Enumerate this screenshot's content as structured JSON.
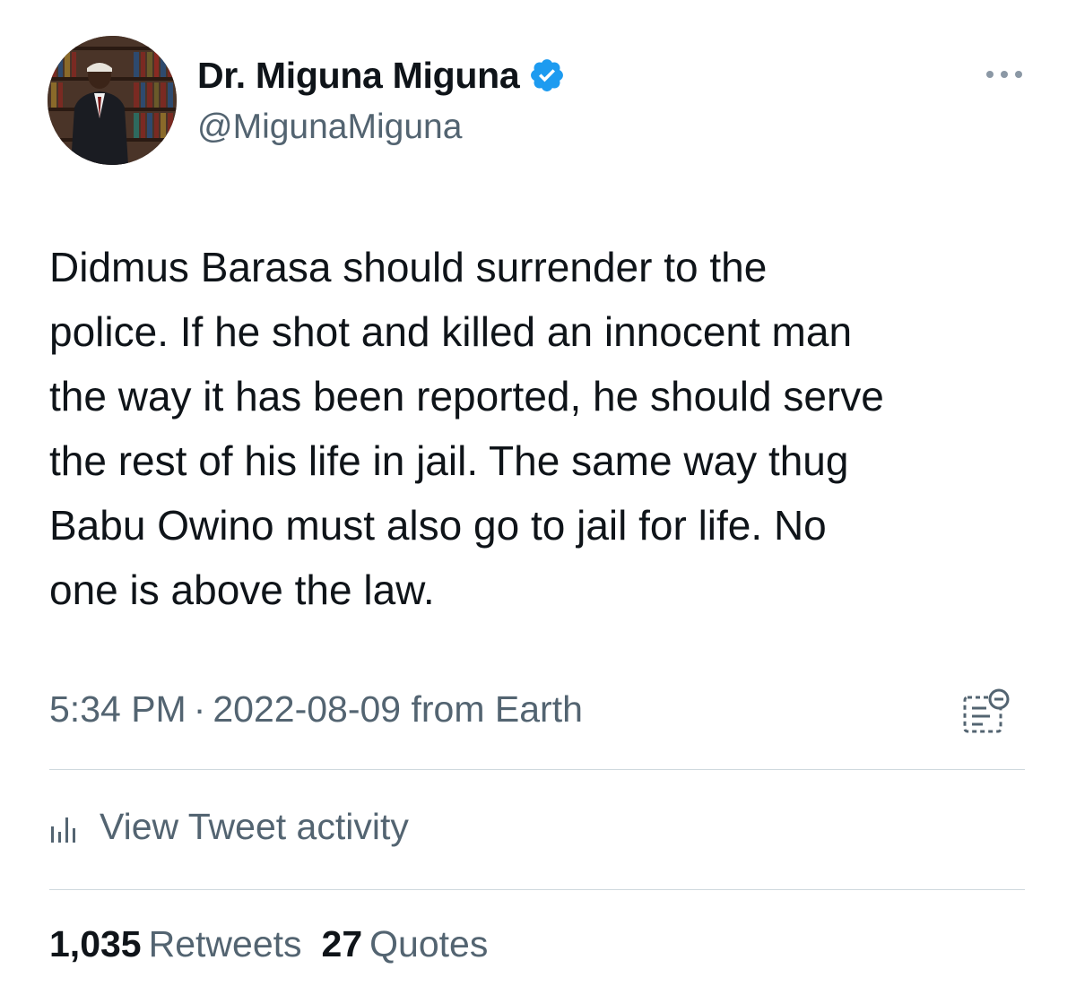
{
  "author": {
    "display_name": "Dr. Miguna Miguna",
    "handle": "@MigunaMiguna",
    "verified": true,
    "avatar_icon": "profile-photo-bookshelf"
  },
  "tweet": {
    "text": "Didmus Barasa should surrender to the\npolice. If he shot and killed an innocent man\nthe way it has been reported, he should serve\nthe rest of his life in jail. The same way thug\nBabu Owino must also go to jail for life. No\none is above the law.",
    "time": "5:34 PM",
    "separator": "·",
    "date": "2022-08-09",
    "source": "from Earth"
  },
  "activity": {
    "label": "View Tweet activity",
    "icon": "bar-chart-icon"
  },
  "stats": {
    "retweets_count": "1,035",
    "retweets_label": "Retweets",
    "quotes_count": "27",
    "quotes_label": "Quotes"
  },
  "icons": {
    "more": "more-horizontal-icon",
    "verified": "verified-badge-icon",
    "edit": "edit-history-icon"
  },
  "colors": {
    "primary_text": "#0f1419",
    "secondary_text": "#536471",
    "verified_blue": "#1d9bf0",
    "divider": "#cfd9de"
  }
}
